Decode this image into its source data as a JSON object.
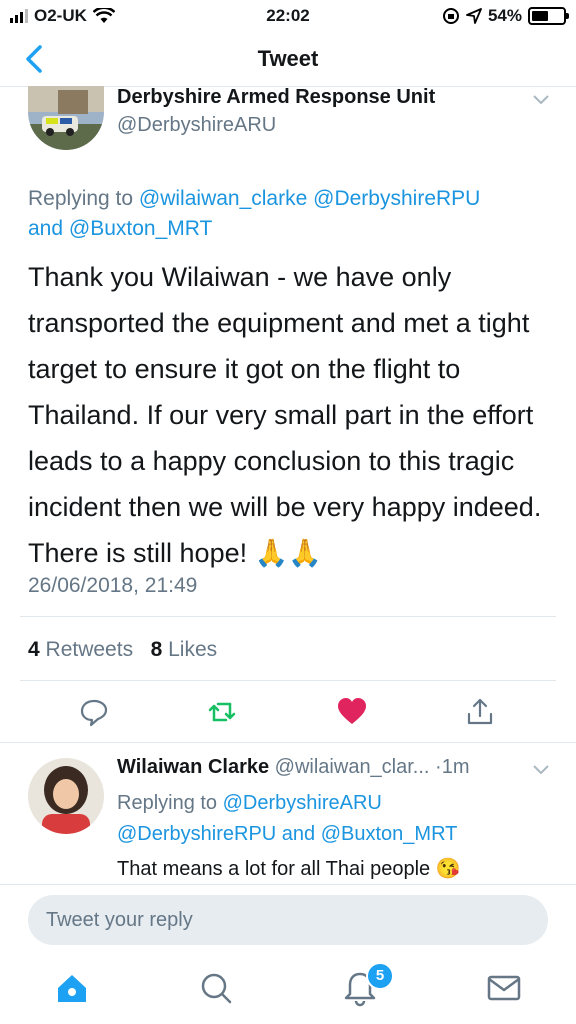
{
  "status_bar": {
    "carrier": "O2-UK",
    "time": "22:02",
    "battery": "54%",
    "battery_level": 0.54
  },
  "nav": {
    "title": "Tweet"
  },
  "tweet": {
    "author_name": "Derbyshire Armed Response Unit",
    "author_handle": "@DerbyshireARU",
    "replying_prefix": "Replying to",
    "replying_user1": "@wilaiwan_clarke",
    "replying_user2": "@DerbyshireRPU",
    "replying_and": "and",
    "replying_user3": "@Buxton_MRT",
    "text": "Thank you Wilaiwan - we have only transported the equipment and met a tight target to ensure it got on the flight to Thailand. If our very small part in the effort leads to a happy conclusion to this tragic incident then we will be very happy indeed. There is still hope! 🙏🙏",
    "date": "26/06/2018, 21:49",
    "retweets_count": "4",
    "retweets_label": "Retweets",
    "likes_count": "8",
    "likes_label": "Likes"
  },
  "reply": {
    "name": "Wilaiwan Clarke",
    "handle": "@wilaiwan_clar...",
    "dot": "·",
    "time": "1m",
    "replying_prefix": "Replying to",
    "replying_user1": "@DerbyshireARU",
    "replying_user2": "@DerbyshireRPU",
    "replying_and": "and",
    "replying_user3": "@Buxton_MRT",
    "text": "That means a lot for all Thai people 😘"
  },
  "composer": {
    "placeholder": "Tweet your reply"
  },
  "tabbar": {
    "notifications_badge": "5"
  },
  "colors": {
    "accent": "#1da1f2",
    "retweet": "#17bf63",
    "like": "#e0245e",
    "muted": "#657786"
  },
  "icons": [
    "back-chevron-icon",
    "wifi-icon",
    "location-arrow-icon",
    "caret-down-icon",
    "reply-icon",
    "retweet-icon",
    "heart-icon",
    "share-icon",
    "home-icon",
    "search-icon",
    "bell-icon",
    "mail-icon"
  ]
}
